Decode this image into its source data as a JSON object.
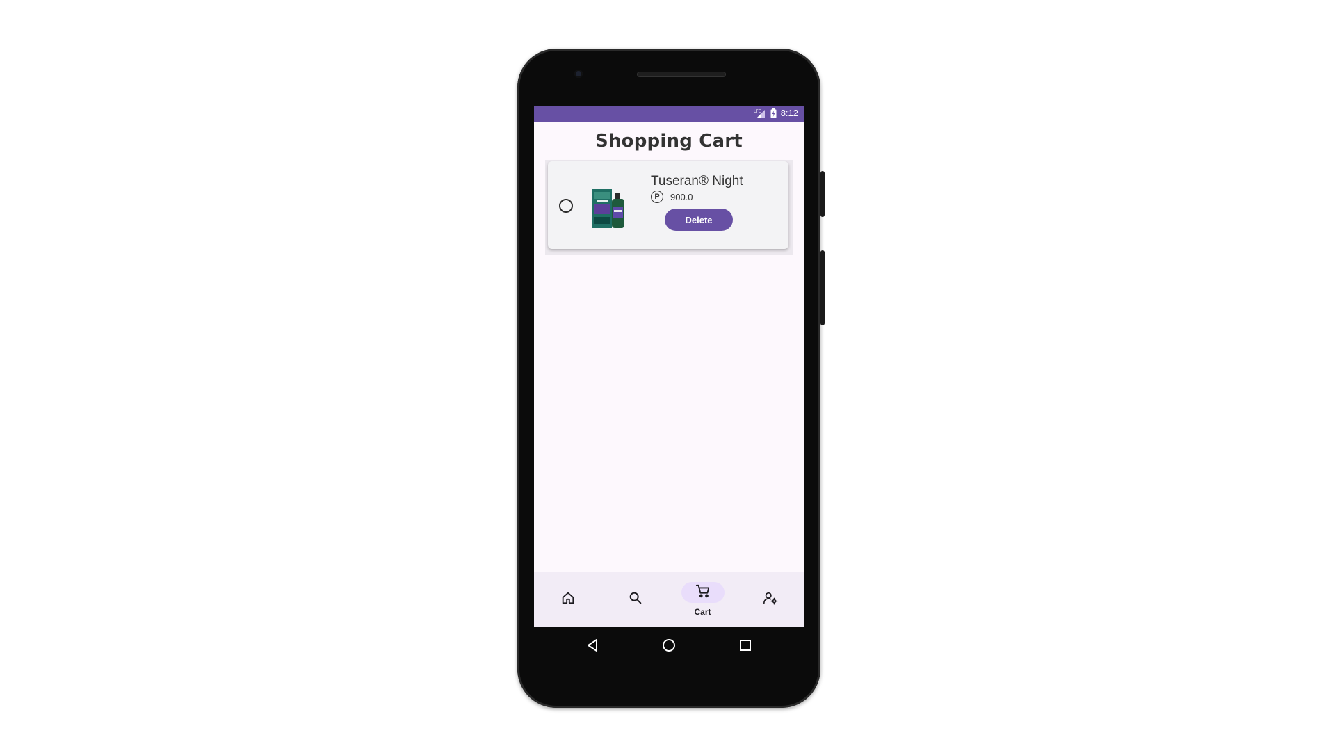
{
  "status_bar": {
    "network_label": "LTE",
    "time": "8:12",
    "background_color": "#6750a4"
  },
  "page": {
    "title": "Shopping Cart"
  },
  "cart": {
    "items": [
      {
        "name": "Tuseran® Night",
        "currency_icon": "peso-icon",
        "currency_symbol": "P",
        "price": "900.0",
        "delete_label": "Delete",
        "selected": false
      }
    ]
  },
  "bottom_nav": {
    "items": [
      {
        "icon": "home-icon",
        "label": "",
        "active": false
      },
      {
        "icon": "search-icon",
        "label": "",
        "active": false
      },
      {
        "icon": "cart-icon",
        "label": "Cart",
        "active": true
      },
      {
        "icon": "manage-account-icon",
        "label": "",
        "active": false
      }
    ],
    "active_pill_color": "#e9ddfb"
  },
  "system_nav": {
    "items": [
      "back-icon",
      "home-circle-icon",
      "recents-icon"
    ]
  },
  "colors": {
    "accent": "#6750a4",
    "screen_background": "#fdf8fd",
    "nav_background": "#f2ecf6"
  }
}
